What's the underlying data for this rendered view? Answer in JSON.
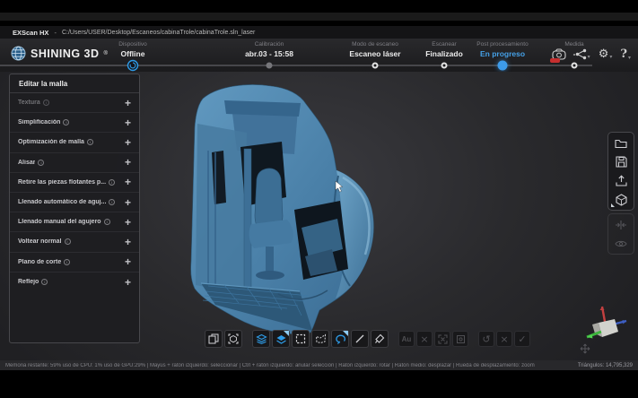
{
  "window": {
    "app_title": "EXScan HX",
    "separator": "-",
    "file_path": "C:/Users/USER/Desktop/Escaneos/cabinaTrole/cabinaTrole.sln_laser"
  },
  "brand": {
    "name": "SHINING 3D",
    "registered": "®"
  },
  "workflow": {
    "steps": [
      {
        "label": "Dispositivo",
        "value": "Offline"
      },
      {
        "label": "Calibración",
        "value": "abr.03 - 15:58"
      },
      {
        "label": "Modo de escaneo",
        "value": "Escaneo láser"
      },
      {
        "label": "Escanear",
        "value": "Finalizado"
      },
      {
        "label": "Post procesamiento",
        "value": "En progreso"
      },
      {
        "label": "Medida",
        "value": "-"
      }
    ],
    "active_step": "Post procesamiento"
  },
  "header_icons": {
    "device": "scanner-device-icon",
    "share": "share-icon",
    "settings": "settings-gear-icon",
    "help": "help-icon",
    "gear_glyph": "⚙",
    "help_glyph": "?",
    "caret_glyph": "▾"
  },
  "left_panel": {
    "title": "Editar la malla",
    "items": [
      {
        "label": "Textura",
        "disabled": true
      },
      {
        "label": "Simplificación",
        "disabled": false
      },
      {
        "label": "Optimización de malla",
        "disabled": false
      },
      {
        "label": "Alisar",
        "disabled": false
      },
      {
        "label": "Retire las piezas flotantes p...",
        "disabled": false
      },
      {
        "label": "Llenado automático de aguj...",
        "disabled": false
      },
      {
        "label": "Llenado manual del agujero",
        "disabled": false
      },
      {
        "label": "Voltear normal",
        "disabled": false
      },
      {
        "label": "Plano de corte",
        "disabled": false
      },
      {
        "label": "Reflejo",
        "disabled": false
      }
    ]
  },
  "icons": {
    "info": "i",
    "plus": "+",
    "undo": "↺",
    "close": "×",
    "check": "✓",
    "auto_select": "Au"
  },
  "bottom_toolbar": {
    "file_group": [
      "import-scan-icon",
      "view-cube-icon"
    ],
    "select_group": [
      "layers-icon",
      "overlay-display-icon",
      "rect-select-icon",
      "polygon-select-icon",
      "lasso-select-icon",
      "line-select-icon",
      "brush-select-icon"
    ],
    "selection_ops_group": [
      "auto-select-icon",
      "deselect-icon",
      "select-all-icon",
      "target-select-icon"
    ],
    "confirm_group": [
      "undo-icon",
      "cancel-icon",
      "confirm-icon"
    ]
  },
  "right_toolbar": {
    "groups": [
      [
        "open-project-icon",
        "save-icon",
        "export-icon",
        "model-view-icon"
      ],
      [
        "fit-view-icon",
        "visibility-icon"
      ]
    ]
  },
  "viewport": {
    "model": "trolleybus-cab-scan-mesh",
    "gizmo": "xyz-axis-gizmo"
  },
  "status_bar": {
    "left": "Memoria restante: 59%  uso de CPU: 1%  uso de GPU:29%  | Mayús + ratón izquierdo: seleccionar | Ctrl + ratón izquierdo: anular selección | Ratón izquierdo: rotar | Ratón medio: desplazar | Rueda de desplazamiento: zoom",
    "right": "Triángulos: 14,795,329"
  },
  "colors": {
    "accent": "#3d9bea",
    "progress_blue": "#45a1e8",
    "model_blue": "#4e86b0"
  }
}
